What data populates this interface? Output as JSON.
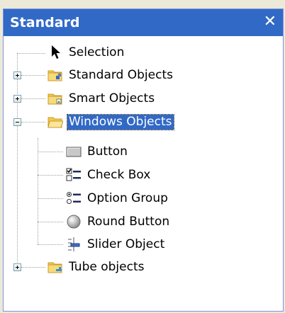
{
  "panel": {
    "title": "Standard",
    "close_glyph": "✕"
  },
  "tree": {
    "items": [
      {
        "label": "Selection",
        "icon": "arrow-cursor-icon"
      },
      {
        "label": "Standard Objects",
        "icon": "folder-icon",
        "expander": "plus"
      },
      {
        "label": "Smart Objects",
        "icon": "folder-icon",
        "expander": "plus"
      },
      {
        "label": "Windows Objects",
        "icon": "folder-open-icon",
        "expander": "minus",
        "selected": true,
        "children": [
          {
            "label": "Button",
            "icon": "button-icon"
          },
          {
            "label": "Check Box",
            "icon": "checkbox-icon"
          },
          {
            "label": "Option Group",
            "icon": "option-group-icon"
          },
          {
            "label": "Round Button",
            "icon": "round-button-icon"
          },
          {
            "label": "Slider Object",
            "icon": "slider-icon"
          }
        ]
      },
      {
        "label": "Tube objects",
        "icon": "folder-icon",
        "expander": "plus"
      }
    ]
  },
  "colors": {
    "title_bar": "#3169c6",
    "selection": "#3169c6"
  }
}
